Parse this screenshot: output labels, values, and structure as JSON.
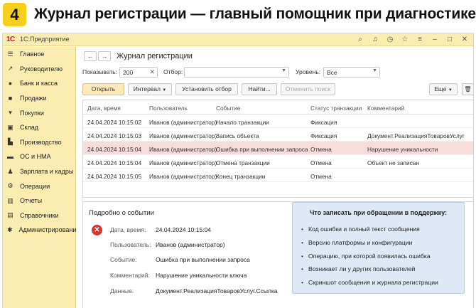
{
  "banner": {
    "step": "4",
    "title": "Журнал регистрации — главный помощник при диагностике"
  },
  "app": {
    "logo": "1С",
    "name": "1С:Предприятие",
    "toolbar_icons": [
      "search-icon",
      "bell-icon",
      "history-icon",
      "star-icon",
      "menu-icon",
      "minimize-icon",
      "maximize-icon",
      "close-icon"
    ]
  },
  "sidebar": {
    "items": [
      {
        "label": "Главное",
        "icon": "menu-icon"
      },
      {
        "label": "Руководителю",
        "icon": "chart-icon"
      },
      {
        "label": "Банк и касса",
        "icon": "bank-icon"
      },
      {
        "label": "Продажи",
        "icon": "bag-icon"
      },
      {
        "label": "Покупки",
        "icon": "cart-icon"
      },
      {
        "label": "Склад",
        "icon": "warehouse-icon"
      },
      {
        "label": "Производство",
        "icon": "factory-icon"
      },
      {
        "label": "ОС и НМА",
        "icon": "truck-icon"
      },
      {
        "label": "Зарплата и кадры",
        "icon": "person-icon"
      },
      {
        "label": "Операции",
        "icon": "gear-icon"
      },
      {
        "label": "Отчеты",
        "icon": "report-icon"
      },
      {
        "label": "Справочники",
        "icon": "book-icon"
      },
      {
        "label": "Администрирование",
        "icon": "settings-icon"
      }
    ]
  },
  "form": {
    "title": "Журнал регистрации",
    "show_label": "Показывать:",
    "show_value": "200",
    "filter_label": "Отбор:",
    "filter_value": "",
    "level_label": "Уровень:",
    "level_value": "Все"
  },
  "toolbar": {
    "open": "Открыть",
    "interval": "Интервал",
    "set_filter": "Установить отбор",
    "find": "Найти...",
    "cancel_search": "Отменить поиск",
    "more": "Еще"
  },
  "table": {
    "columns": [
      "Дата, время",
      "Пользователь",
      "Событие",
      "Статус транзакции",
      "Комментарий"
    ],
    "rows": [
      [
        "24.04.2024 10:15:02",
        "Иванов (администратор)",
        "Начало транзакции",
        "Фиксация",
        ""
      ],
      [
        "24.04.2024 10:15:03",
        "Иванов (администратор)",
        "Запись объекта",
        "Фиксация",
        "Документ.РеализацияТоваровУслуг"
      ],
      [
        "24.04.2024 10:15:04",
        "Иванов (администратор)",
        "Ошибка при выполнении запроса",
        "Отмена",
        "Нарушение уникальности"
      ],
      [
        "24.04.2024 10:15:04",
        "Иванов (администратор)",
        "Отмена транзакции",
        "Отмена",
        "Объект не записан"
      ],
      [
        "24.04.2024 10:15:05",
        "Иванов (администратор)",
        "Конец транзакции",
        "Отмена",
        ""
      ]
    ],
    "error_row_color": "#f7dcdc"
  },
  "details": {
    "title": "Подробно о событии",
    "date_label": "Дата, время:",
    "date_value": "24.04.2024 10:15:04",
    "user_label": "Пользователь:",
    "user_value": "Иванов (администратор)",
    "event_label": "Событие:",
    "event_value": "Ошибка при выполнении запроса",
    "comment_label": "Комментарий:",
    "comment_value": "Нарушение уникальности ключа",
    "data_label": "Данные:",
    "data_value": "Документ.РеализацияТоваровУслуг.Ссылка"
  },
  "help": {
    "title": "Что записать при обращении в поддержку:",
    "items": [
      "Код ошибки и полный текст сообщения",
      "Версию платформы и конфигурации",
      "Операцию, при которой появилась ошибка",
      "Возникает ли у других пользователей",
      "Скриншот сообщения и журнала регистрации"
    ]
  }
}
